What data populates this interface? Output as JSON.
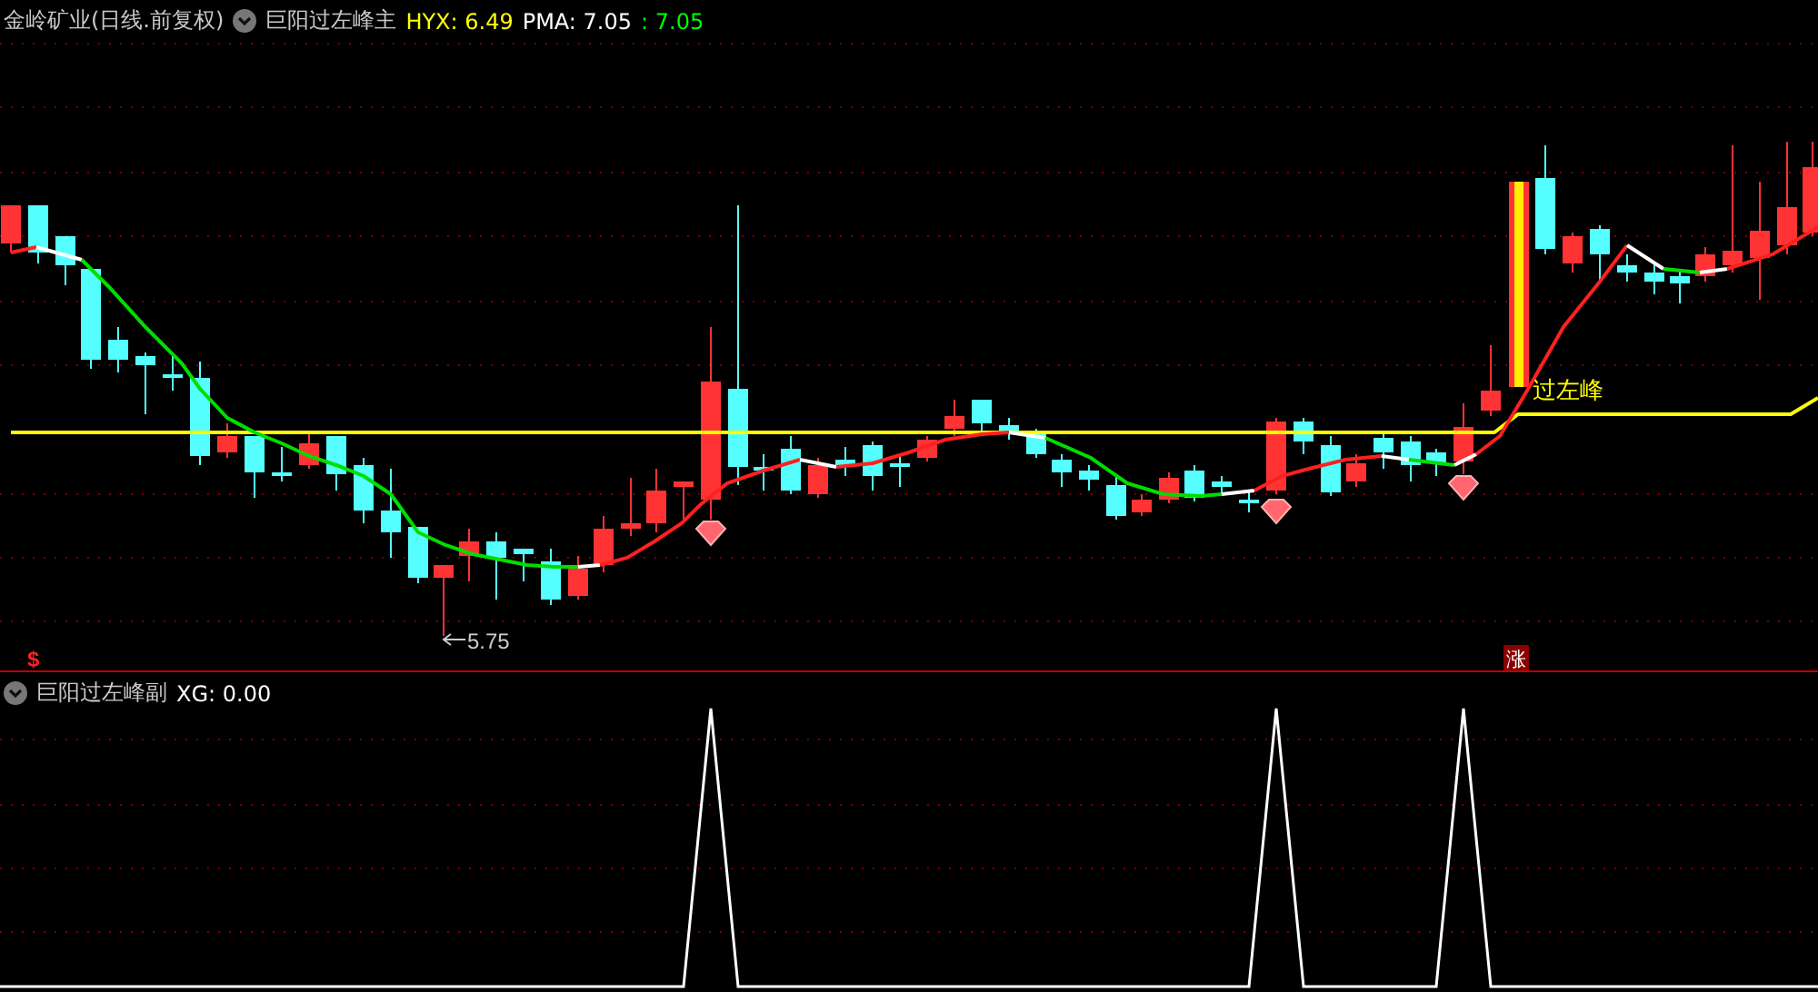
{
  "main_panel": {
    "title": "金岭矿业(日线.前复权)",
    "indicator": "巨阳过左峰主",
    "readouts": [
      {
        "text": "HYX: 6.49",
        "color": "#ffff00"
      },
      {
        "text": "PMA: 7.05",
        "color": "#ffffff"
      },
      {
        "text": ": 7.05",
        "color": "#00ff00"
      }
    ],
    "low_label": "5.75",
    "signal_label": "过左峰",
    "left_marker": "$",
    "rise_badge": "涨"
  },
  "sub_panel": {
    "indicator": "巨阳过左峰副",
    "readouts": [
      {
        "text": "XG: 0.00",
        "color": "#ffffff"
      }
    ]
  }
}
